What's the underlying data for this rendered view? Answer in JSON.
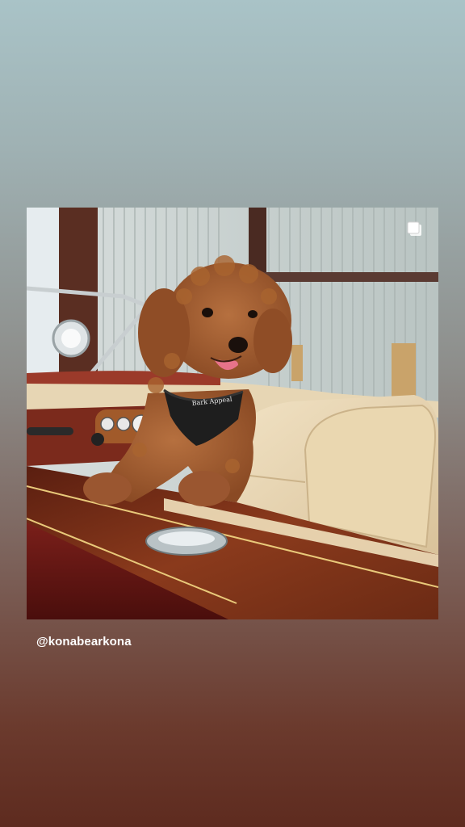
{
  "story": {
    "mention": "@konabearkona",
    "harness_text": "Bark Appeal"
  },
  "post": {
    "multi_image_icon": "carousel-stack-icon"
  },
  "colors": {
    "background_top": "#a9c3c7",
    "background_bottom": "#5e2b1f",
    "mention_text": "#ffffff"
  }
}
